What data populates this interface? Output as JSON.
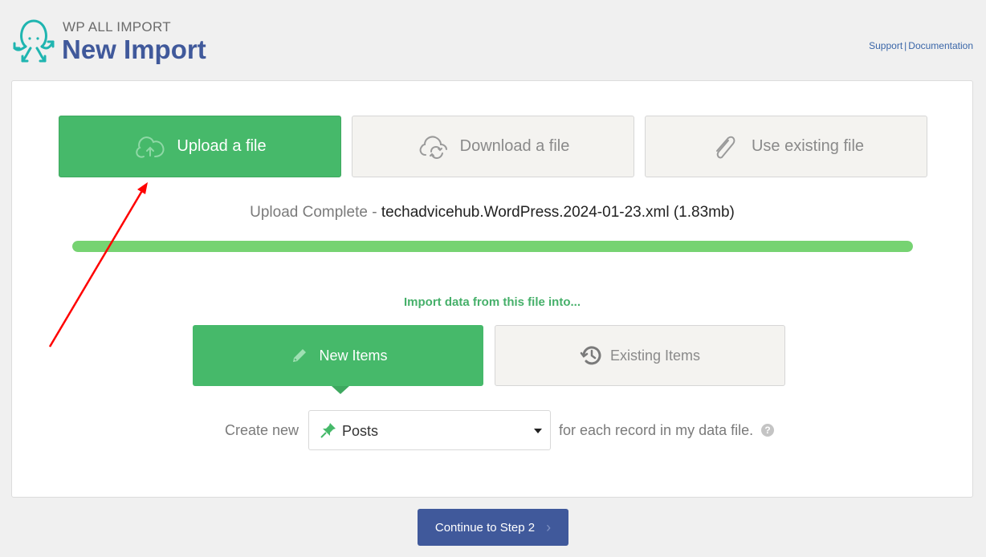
{
  "header": {
    "brand": "WP ALL IMPORT",
    "title": "New Import",
    "links": {
      "support": "Support",
      "separator": "|",
      "documentation": "Documentation"
    }
  },
  "source_options": [
    {
      "label": "Upload a file",
      "icon": "cloud-upload-icon",
      "state": "active"
    },
    {
      "label": "Download a file",
      "icon": "cloud-sync-icon",
      "state": "inactive"
    },
    {
      "label": "Use existing file",
      "icon": "paperclip-icon",
      "state": "inactive"
    }
  ],
  "upload_status": {
    "label": "Upload Complete",
    "separator": " - ",
    "filename": "techadvicehub.WordPress.2024-01-23.xml (1.83mb)",
    "progress_percent": 100
  },
  "import_into": {
    "heading": "Import data from this file into...",
    "options": [
      {
        "label": "New Items",
        "icon": "pencil-icon",
        "state": "active"
      },
      {
        "label": "Existing Items",
        "icon": "history-icon",
        "state": "inactive"
      }
    ]
  },
  "create_row": {
    "prefix": "Create new",
    "selected_type": "Posts",
    "suffix": "for each record in my data file.",
    "help": "?"
  },
  "footer": {
    "continue_label": "Continue to Step 2",
    "chevron": "›"
  },
  "colors": {
    "accent_green": "#46b96a",
    "progress": "#76d372",
    "primary_blue": "#40599b",
    "annotation_red": "#ff0000"
  }
}
